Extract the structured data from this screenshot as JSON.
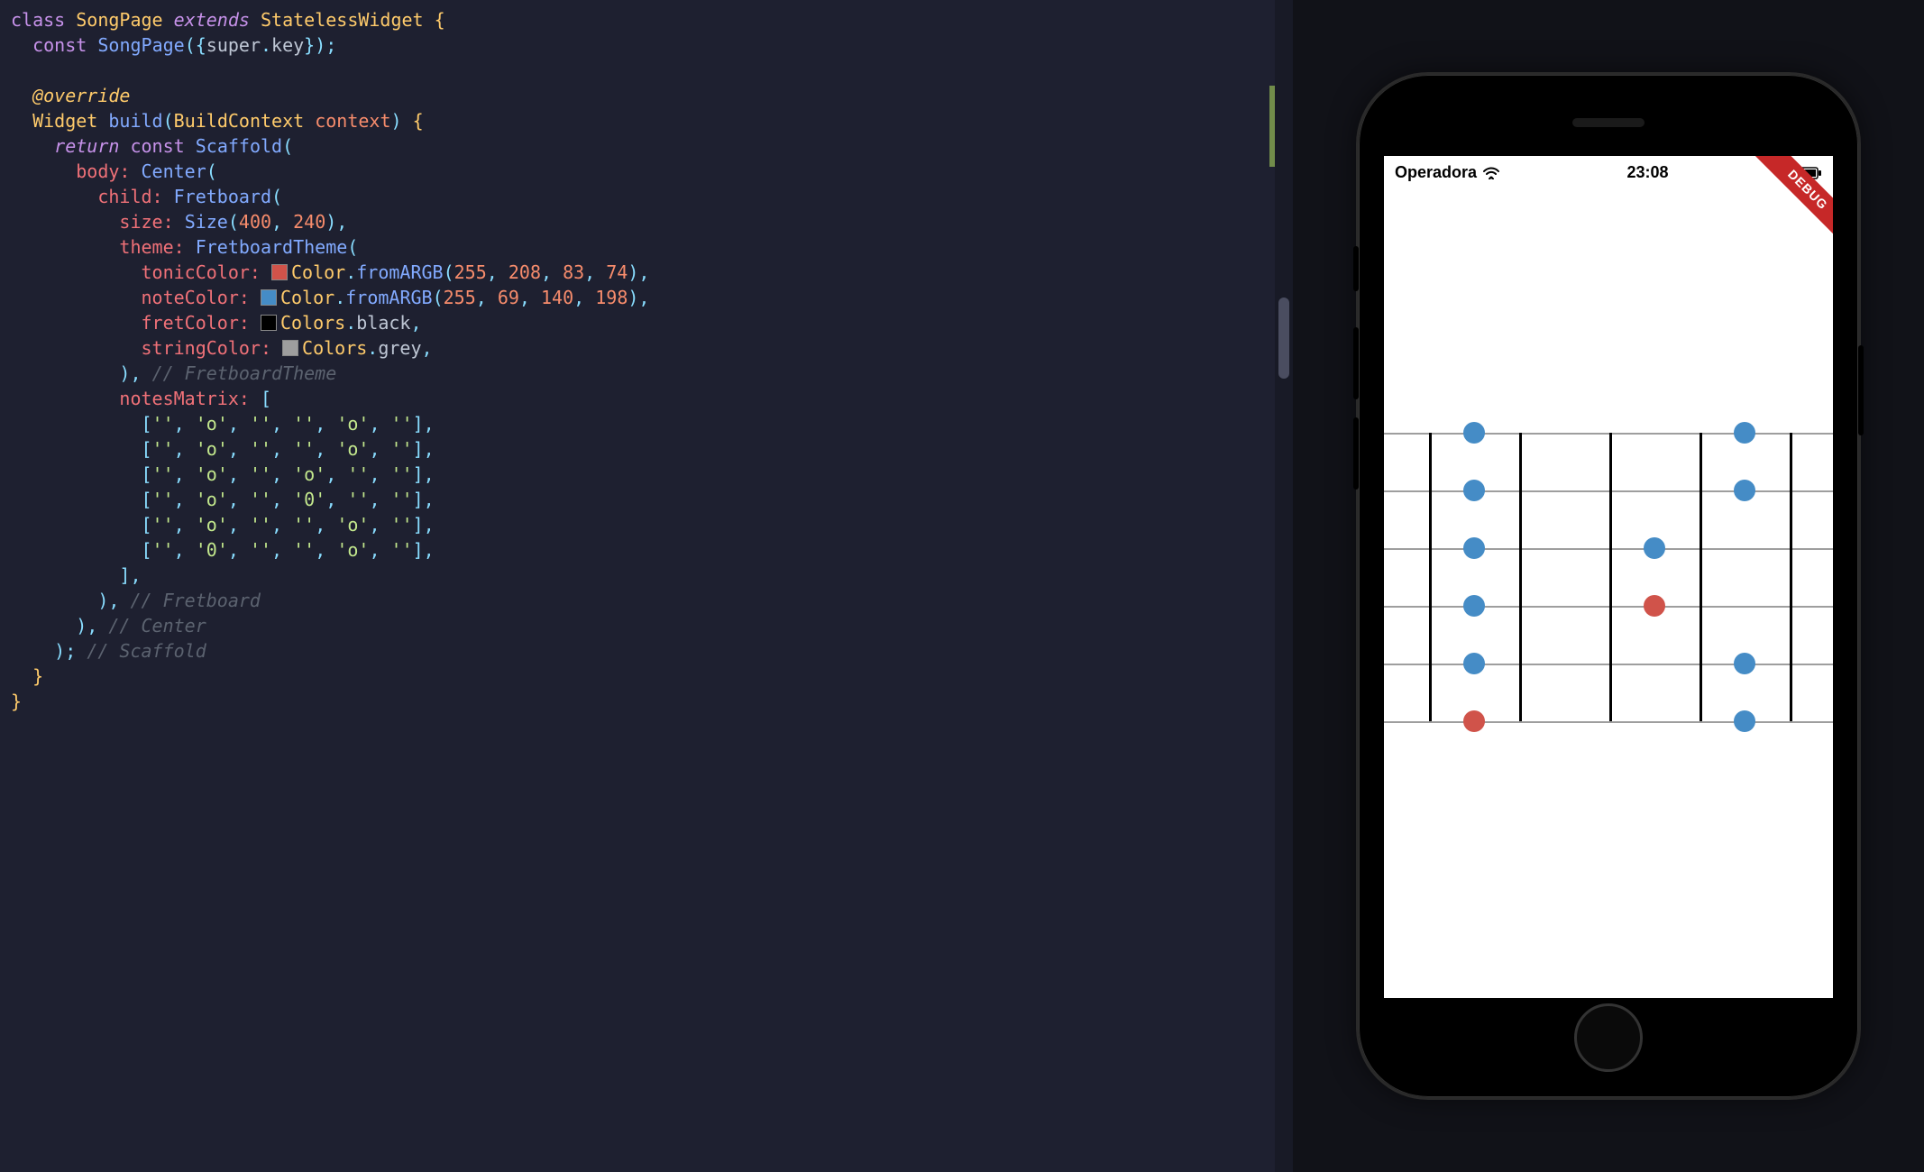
{
  "code": {
    "class_name": "SongPage",
    "extends": "StatelessWidget",
    "constructor": "const SongPage({super.key});",
    "annotation": "@override",
    "build_sig": "Widget build(BuildContext context) {",
    "return_kw": "return",
    "scaffold": "Scaffold",
    "body_label": "body:",
    "center": "Center",
    "child_label": "child:",
    "fretboard": "Fretboard",
    "size_label": "size:",
    "size_call": "Size",
    "size_args": [
      "400",
      "240"
    ],
    "theme_label": "theme:",
    "theme_class": "FretboardTheme",
    "tonic_label": "tonicColor:",
    "note_label": "noteColor:",
    "fret_label": "fretColor:",
    "string_label": "stringColor:",
    "color_class": "Color",
    "colors_class": "Colors",
    "fromARGB": "fromARGB",
    "tonic_args": [
      "255",
      "208",
      "83",
      "74"
    ],
    "note_args": [
      "255",
      "69",
      "140",
      "198"
    ],
    "black": "black",
    "grey": "grey",
    "comment_theme": "// FretboardTheme",
    "notes_label": "notesMatrix:",
    "matrix": [
      [
        "''",
        "'o'",
        "''",
        "''",
        "'o'",
        "''"
      ],
      [
        "''",
        "'o'",
        "''",
        "''",
        "'o'",
        "''"
      ],
      [
        "''",
        "'o'",
        "''",
        "'o'",
        "''",
        "''"
      ],
      [
        "''",
        "'o'",
        "''",
        "'0'",
        "''",
        "''"
      ],
      [
        "''",
        "'o'",
        "''",
        "''",
        "'o'",
        "''"
      ],
      [
        "''",
        "'0'",
        "''",
        "''",
        "'o'",
        "''"
      ]
    ],
    "comment_fretboard": "// Fretboard",
    "comment_center": "// Center",
    "comment_scaffold": "// Scaffold"
  },
  "simulator": {
    "carrier": "Operadora",
    "time": "23:08",
    "debug": "DEBUG",
    "fretboard": {
      "strings": 6,
      "frets": 5,
      "tonicColor": "#d0534a",
      "noteColor": "#458cc6",
      "notes": [
        {
          "string": 0,
          "fret": 1,
          "type": "o"
        },
        {
          "string": 0,
          "fret": 4,
          "type": "o"
        },
        {
          "string": 1,
          "fret": 1,
          "type": "o"
        },
        {
          "string": 1,
          "fret": 4,
          "type": "o"
        },
        {
          "string": 2,
          "fret": 1,
          "type": "o"
        },
        {
          "string": 2,
          "fret": 3,
          "type": "o"
        },
        {
          "string": 3,
          "fret": 1,
          "type": "o"
        },
        {
          "string": 3,
          "fret": 3,
          "type": "0"
        },
        {
          "string": 4,
          "fret": 1,
          "type": "o"
        },
        {
          "string": 4,
          "fret": 4,
          "type": "o"
        },
        {
          "string": 5,
          "fret": 1,
          "type": "0"
        },
        {
          "string": 5,
          "fret": 4,
          "type": "o"
        }
      ]
    }
  }
}
